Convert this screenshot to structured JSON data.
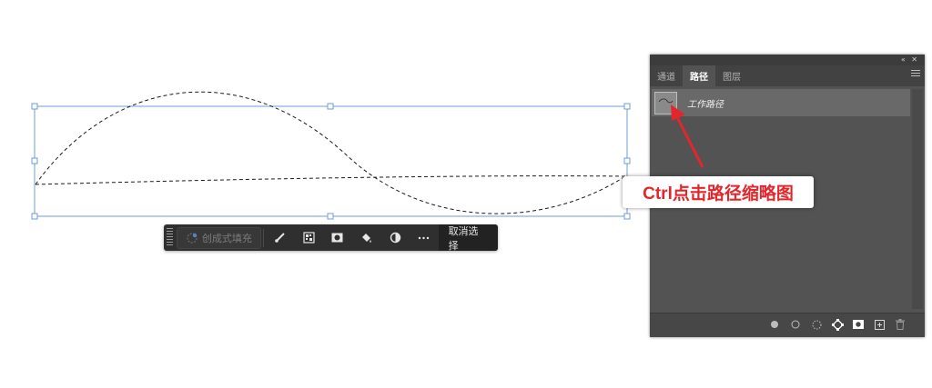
{
  "canvas": {
    "selection_color": "#6f9bd8"
  },
  "taskbar": {
    "generative_fill_label": "创成式填充",
    "tools": [
      {
        "name": "brush-icon"
      },
      {
        "name": "mask-grid-icon"
      },
      {
        "name": "mask-icon"
      },
      {
        "name": "fill-bucket-icon"
      },
      {
        "name": "adjustment-icon"
      },
      {
        "name": "more-icon"
      }
    ],
    "deselect_label": "取消选择"
  },
  "panel": {
    "tabs": [
      "通道",
      "路径",
      "图层"
    ],
    "active_tab": "路径",
    "path_item_label": "工作路径",
    "footer_icons": [
      "fill-path-icon",
      "stroke-path-icon",
      "load-selection-icon",
      "make-path-icon",
      "add-mask-icon",
      "new-path-icon",
      "delete-icon"
    ]
  },
  "annotation": {
    "text": "Ctrl点击路径缩略图",
    "color": "#e3262c"
  }
}
